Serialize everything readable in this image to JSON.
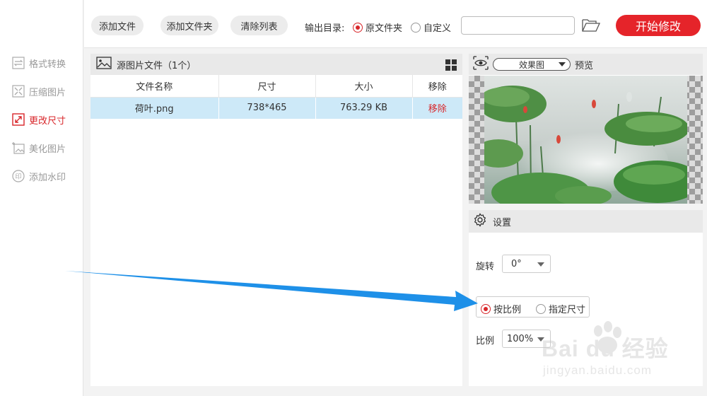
{
  "sidebar": {
    "items": [
      {
        "label": "格式转换",
        "icon": "format-convert-icon"
      },
      {
        "label": "压缩图片",
        "icon": "compress-icon"
      },
      {
        "label": "更改尺寸",
        "icon": "resize-icon",
        "active": true
      },
      {
        "label": "美化图片",
        "icon": "beautify-icon"
      },
      {
        "label": "添加水印",
        "icon": "watermark-icon"
      }
    ]
  },
  "toolbar": {
    "add_file": "添加文件",
    "add_folder": "添加文件夹",
    "clear_list": "清除列表",
    "output_label": "输出目录:",
    "output_options": [
      {
        "label": "原文件夹",
        "selected": true
      },
      {
        "label": "自定义",
        "selected": false
      }
    ],
    "path_value": "",
    "start": "开始修改"
  },
  "file_panel": {
    "title": "源图片文件（1个）",
    "columns": [
      "文件名称",
      "尺寸",
      "大小",
      "移除"
    ],
    "rows": [
      {
        "name": "荷叶.png",
        "dims": "738*465",
        "size": "763.29 KB",
        "remove": "移除"
      }
    ]
  },
  "preview": {
    "mode": "效果图",
    "label": "预览"
  },
  "settings": {
    "title": "设置",
    "rotate_label": "旋转",
    "rotate_value": "0°",
    "mode_options": [
      {
        "label": "按比例",
        "selected": true
      },
      {
        "label": "指定尺寸",
        "selected": false
      }
    ],
    "ratio_label": "比例",
    "ratio_value": "100%"
  },
  "watermark": {
    "line1": "Bai du 经验",
    "line2": "jingyan.baidu.com"
  },
  "colors": {
    "accent": "#e5242a",
    "selected_row": "#cde9f8",
    "annotation_arrow": "#1e90e8"
  }
}
